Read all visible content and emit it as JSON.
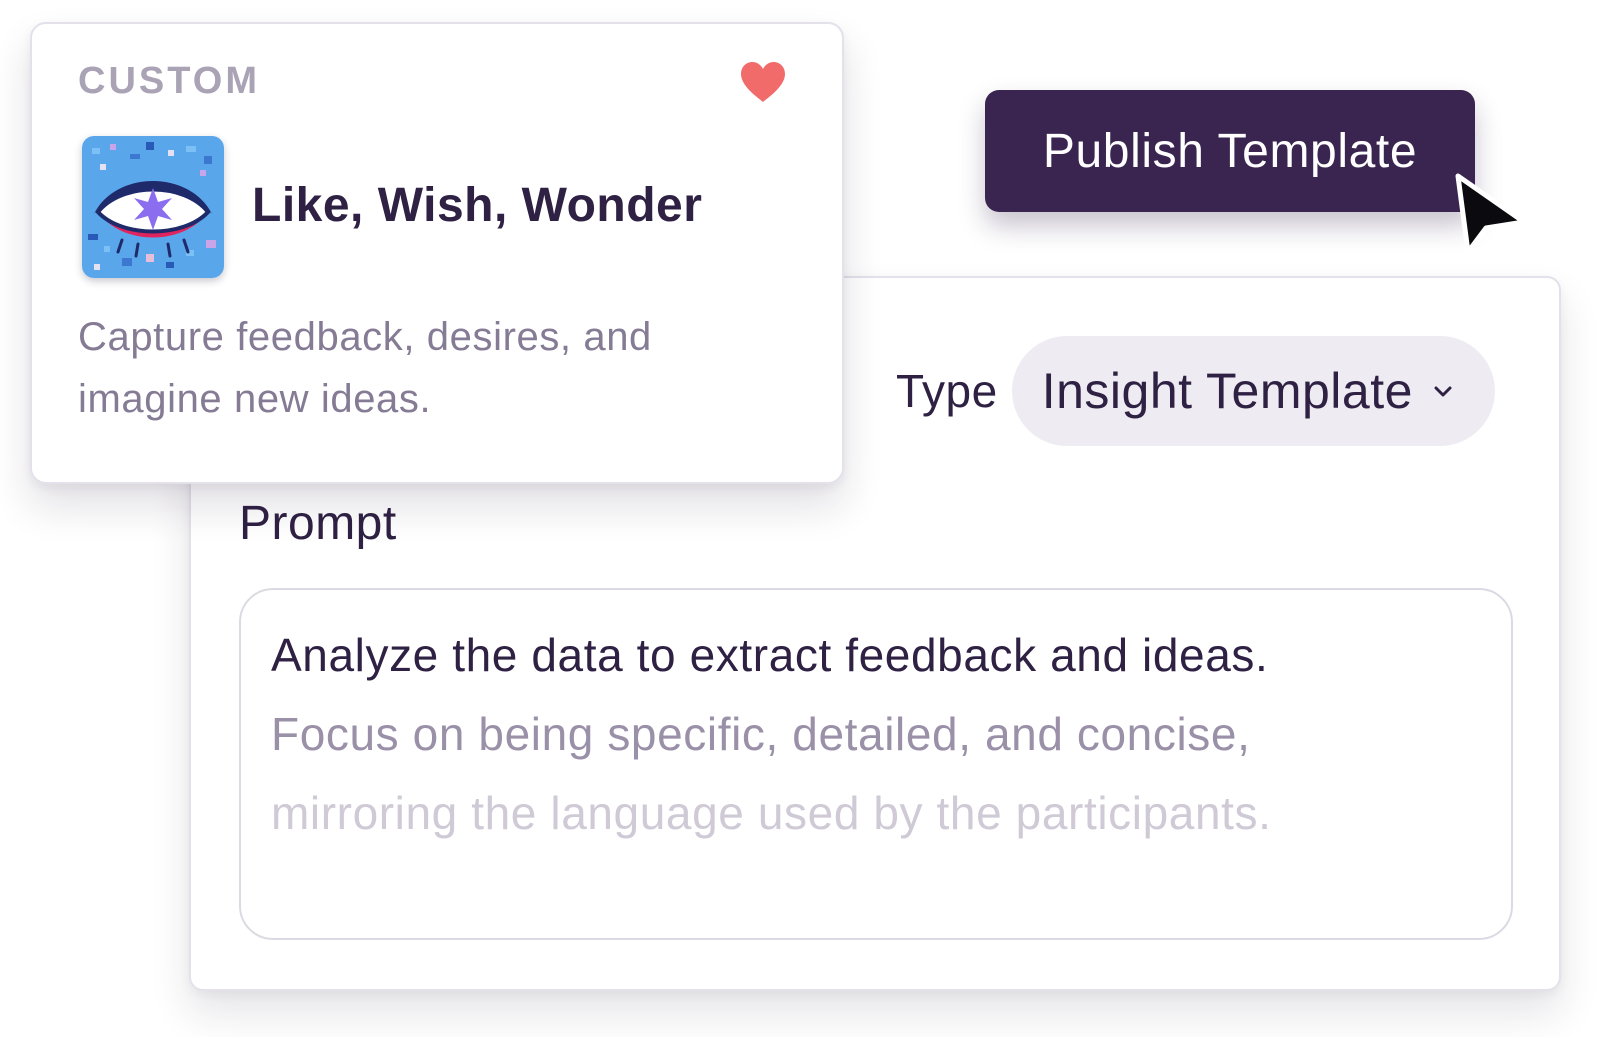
{
  "card": {
    "tag": "CUSTOM",
    "title": "Like, Wish, Wonder",
    "description": "Capture feedback, desires, and imagine new ideas.",
    "favorite_icon": "heart-icon",
    "thumbnail_icon": "eye-icon"
  },
  "publish": {
    "label": "Publish Template"
  },
  "editor": {
    "type_label": "Type",
    "type_value": "Insight Template",
    "prompt_label": "Prompt",
    "prompt_lines": [
      "Analyze the data to extract feedback and ideas.",
      "Focus on being specific, detailed, and concise,",
      "mirroring the language used by the participants."
    ]
  },
  "colors": {
    "brand_dark": "#3a2550",
    "text_primary": "#2e2143",
    "text_muted": "#857b95",
    "heart": "#f26b6b",
    "select_bg": "#eeecf2"
  }
}
